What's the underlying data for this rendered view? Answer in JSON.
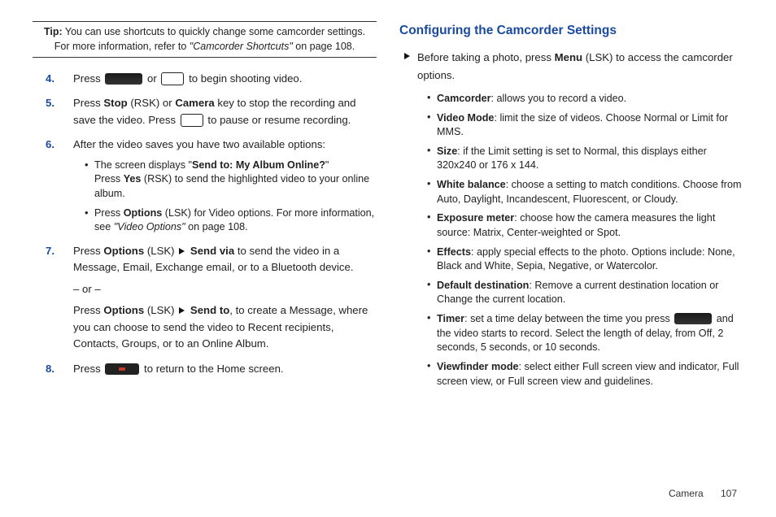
{
  "tip": {
    "label": "Tip:",
    "text_a": "You can use shortcuts to quickly change some camcorder settings. For more information, refer to ",
    "ref": "\"Camcorder Shortcuts\"",
    "text_b": " on page 108."
  },
  "left": {
    "s4": {
      "num": "4.",
      "a": "Press ",
      "b": " or ",
      "c": " to begin shooting video."
    },
    "s5": {
      "num": "5.",
      "a": "Press ",
      "stop": "Stop",
      "b": " (RSK) or ",
      "cam": "Camera",
      "c": " key to stop the recording and save the video. Press ",
      "d": " to pause or resume recording."
    },
    "s6": {
      "num": "6.",
      "intro": "After the video saves you have two available options:",
      "b1a": "The screen displays \"",
      "b1bold": "Send to: My Album Online?",
      "b1b": "\"",
      "b1c": "Press ",
      "b1yes": "Yes",
      "b1d": " (RSK) to send the highlighted video to your online album.",
      "b2a": "Press ",
      "b2opt": "Options",
      "b2b": " (LSK) for Video options. For more information, see ",
      "b2ref": "\"Video Options\"",
      "b2c": " on page 108."
    },
    "s7": {
      "num": "7.",
      "a": "Press ",
      "opt": "Options",
      "b": " (LSK) ",
      "sendvia": "Send via",
      "c": " to send the video in a Message, Email, Exchange email, or to a Bluetooth device.",
      "or": "– or –",
      "d": "Press ",
      "opt2": "Options",
      "e": " (LSK) ",
      "sendto": "Send to",
      "f": ", to create a Message, where you can choose to send the video to Recent recipients, Contacts, Groups, or to an Online Album."
    },
    "s8": {
      "num": "8.",
      "a": "Press ",
      "b": " to return to the Home screen."
    }
  },
  "right": {
    "heading": "Configuring the Camcorder Settings",
    "lead_a": "Before taking a photo, press ",
    "lead_bold": "Menu",
    "lead_b": " (LSK) to access the camcorder options.",
    "items": [
      {
        "name": "Camcorder",
        "desc": ": allows you to record a video."
      },
      {
        "name": "Video Mode",
        "desc": ": limit the size of videos. Choose Normal or Limit for MMS."
      },
      {
        "name": "Size",
        "desc": ": if the Limit setting is set to Normal, this displays either 320x240 or 176 x 144."
      },
      {
        "name": "White balance",
        "desc": ": choose a setting to match conditions. Choose from Auto, Daylight, Incandescent, Fluorescent, or Cloudy."
      },
      {
        "name": "Exposure meter",
        "desc": ": choose how the camera measures the light source: Matrix, Center-weighted or Spot."
      },
      {
        "name": "Effects",
        "desc": ": apply special effects to the photo. Options include: None, Black and White, Sepia, Negative, or Watercolor."
      },
      {
        "name": "Default destination",
        "desc": ": Remove a current destination location or Change the current location."
      },
      {
        "name": "Timer",
        "desc_a": ": set a time delay between the time you press ",
        "desc_b": " and the video starts to record. Select the length of delay, from Off, 2 seconds, 5 seconds, or 10 seconds."
      },
      {
        "name": "Viewfinder mode",
        "desc": ": select either Full screen view and indicator, Full screen view, or Full screen view and guidelines."
      }
    ]
  },
  "footer": {
    "section": "Camera",
    "page": "107"
  }
}
